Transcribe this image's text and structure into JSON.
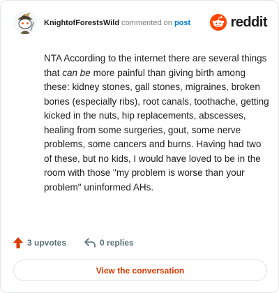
{
  "header": {
    "username": "KnightofForestsWild",
    "action_text": "commented on",
    "post_link": "post",
    "brand": "reddit"
  },
  "comment": {
    "part1": "NTA According to the internet there are several things that ",
    "emphasis": "can be",
    "part2": " more painful than giving birth among these: kidney stones, gall stones, migraines, broken bones (especially ribs), root canals, toothache, getting kicked in the nuts, hip replacements, abscesses, healing from some surgeries, gout, some nerve problems, some cancers and burns. Having had two of these, but no kids, I would have loved to be in the room with those \"my problem is worse than your problem\" uninformed AHs."
  },
  "actions": {
    "upvotes": "3 upvotes",
    "replies": "0 replies"
  },
  "view_button": "View the conversation",
  "colors": {
    "brand_orange": "#ff4500",
    "upvote": "#d93a00",
    "link": "#0079d3"
  },
  "icons": {
    "avatar": "snoo-avatar",
    "brand": "reddit-logo-icon",
    "upvote": "upvote-arrow-icon",
    "reply": "reply-arrow-icon"
  }
}
